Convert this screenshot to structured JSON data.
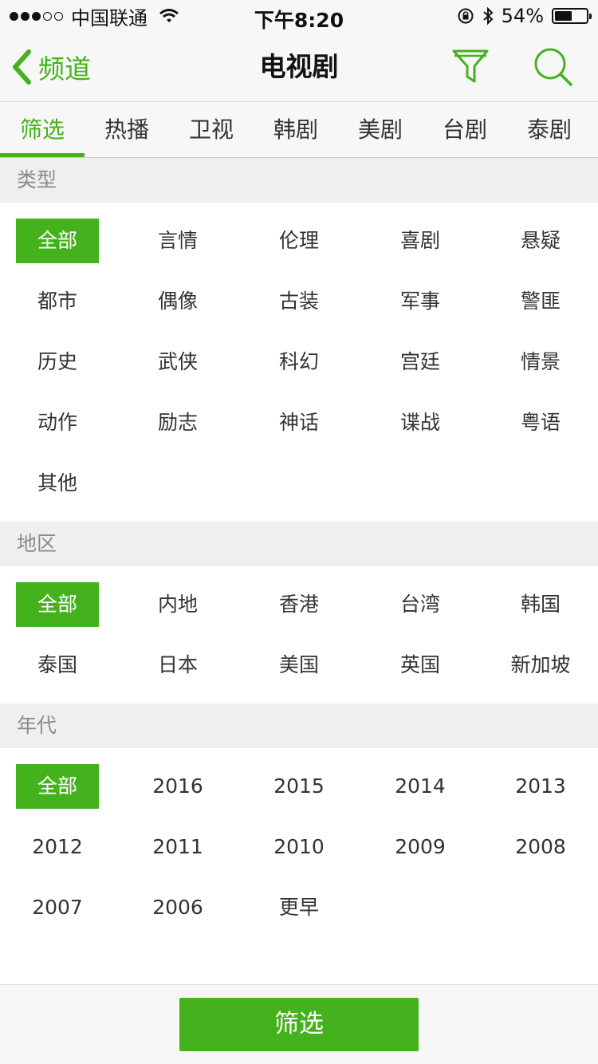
{
  "status_bar": {
    "carrier": "中国联通",
    "time": "下午8:20",
    "battery_text": "54%",
    "battery_level": 0.54,
    "signal_bars_filled": 3,
    "signal_bars_total": 5
  },
  "nav": {
    "back_label": "频道",
    "title": "电视剧",
    "icons": [
      "chevron-left-icon",
      "filter-funnel-icon",
      "search-icon"
    ]
  },
  "tabs": [
    "筛选",
    "热播",
    "卫视",
    "韩剧",
    "美剧",
    "台剧",
    "泰剧"
  ],
  "active_tab": "筛选",
  "sections": {
    "type": {
      "title": "类型",
      "selected": "全部",
      "options": [
        "全部",
        "言情",
        "伦理",
        "喜剧",
        "悬疑",
        "都市",
        "偶像",
        "古装",
        "军事",
        "警匪",
        "历史",
        "武侠",
        "科幻",
        "宫廷",
        "情景",
        "动作",
        "励志",
        "神话",
        "谍战",
        "粤语",
        "其他"
      ]
    },
    "region": {
      "title": "地区",
      "selected": "全部",
      "options": [
        "全部",
        "内地",
        "香港",
        "台湾",
        "韩国",
        "泰国",
        "日本",
        "美国",
        "英国",
        "新加坡"
      ]
    },
    "year": {
      "title": "年代",
      "selected": "全部",
      "options": [
        "全部",
        "2016",
        "2015",
        "2014",
        "2013",
        "2012",
        "2011",
        "2010",
        "2009",
        "2008",
        "2007",
        "2006",
        "更早"
      ]
    }
  },
  "bottom": {
    "filter_button": "筛选"
  },
  "colors": {
    "accent": "#44b21c",
    "section_bg": "#efefef",
    "bar_bg": "#f7f7f7"
  }
}
